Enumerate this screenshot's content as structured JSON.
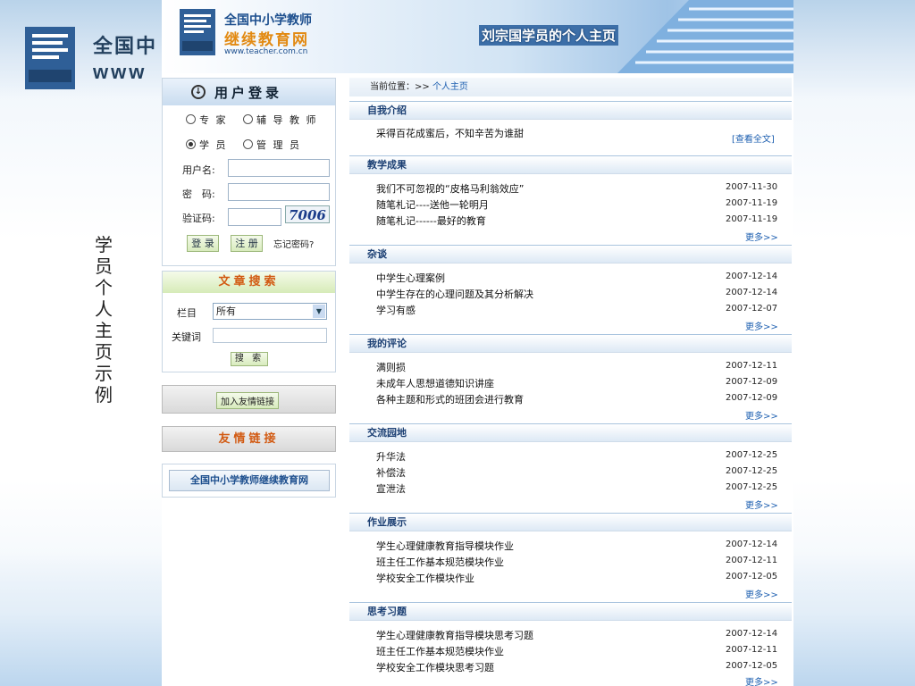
{
  "background": {
    "site_name": "全国中",
    "url_fragment": "www",
    "vertical_caption": "学员个人主页示例"
  },
  "banner": {
    "site_title": "全国中小学教师",
    "site_subtitle": "继续教育网",
    "site_url": "www.teacher.com.cn",
    "logo_text": "TEACHER",
    "page_owner": "刘宗国学员的个人主页"
  },
  "login": {
    "title": "用户登录",
    "roles": [
      {
        "label": "专 家",
        "selected": false
      },
      {
        "label": "辅 导 教 师",
        "selected": false
      },
      {
        "label": "学 员",
        "selected": true
      },
      {
        "label": "管 理 员",
        "selected": false
      }
    ],
    "username_label": "用户名:",
    "password_label": "密　码:",
    "captcha_label": "验证码:",
    "captcha_value": "7006",
    "login_button": "登 录",
    "register_button": "注 册",
    "forgot_link": "忘记密码?"
  },
  "search": {
    "title": "文章搜索",
    "column_label": "栏目",
    "column_value": "所有",
    "keyword_label": "关键词",
    "search_button": "搜 索"
  },
  "links": {
    "add_link_button": "加入友情链接",
    "friends_title": "友情链接",
    "friend_site": "全国中小学教师继续教育网"
  },
  "location": {
    "prefix": "当前位置：>> ",
    "current": "个人主页"
  },
  "sections": [
    {
      "title": "自我介绍",
      "text": "采得百花成蜜后，不知辛苦为谁甜",
      "more": "[查看全文]"
    },
    {
      "title": "教学成果",
      "items": [
        {
          "title": "我们不可忽视的“皮格马利翁效应”",
          "date": "2007-11-30"
        },
        {
          "title": "随笔札记----送他一轮明月",
          "date": "2007-11-19"
        },
        {
          "title": "随笔札记------最好的教育",
          "date": "2007-11-19"
        }
      ],
      "more": "更多>>"
    },
    {
      "title": "杂谈",
      "items": [
        {
          "title": "中学生心理案例",
          "date": "2007-12-14"
        },
        {
          "title": "中学生存在的心理问题及其分析解决",
          "date": "2007-12-14"
        },
        {
          "title": "学习有感",
          "date": "2007-12-07"
        }
      ],
      "more": "更多>>"
    },
    {
      "title": "我的评论",
      "items": [
        {
          "title": "满则损",
          "date": "2007-12-11"
        },
        {
          "title": "未成年人思想道德知识讲座",
          "date": "2007-12-09"
        },
        {
          "title": "各种主题和形式的班团会进行教育",
          "date": "2007-12-09"
        }
      ],
      "more": "更多>>"
    },
    {
      "title": "交流园地",
      "items": [
        {
          "title": "升华法",
          "date": "2007-12-25"
        },
        {
          "title": "补偿法",
          "date": "2007-12-25"
        },
        {
          "title": "宣泄法",
          "date": "2007-12-25"
        }
      ],
      "more": "更多>>"
    },
    {
      "title": "作业展示",
      "items": [
        {
          "title": "学生心理健康教育指导模块作业",
          "date": "2007-12-14"
        },
        {
          "title": "班主任工作基本规范模块作业",
          "date": "2007-12-11"
        },
        {
          "title": "学校安全工作模块作业",
          "date": "2007-12-05"
        }
      ],
      "more": "更多>>"
    },
    {
      "title": "思考习题",
      "items": [
        {
          "title": "学生心理健康教育指导模块思考习题",
          "date": "2007-12-14"
        },
        {
          "title": "班主任工作基本规范模块作业",
          "date": "2007-12-11"
        },
        {
          "title": "学校安全工作模块思考习题",
          "date": "2007-12-05"
        }
      ],
      "more": "更多>>"
    }
  ]
}
